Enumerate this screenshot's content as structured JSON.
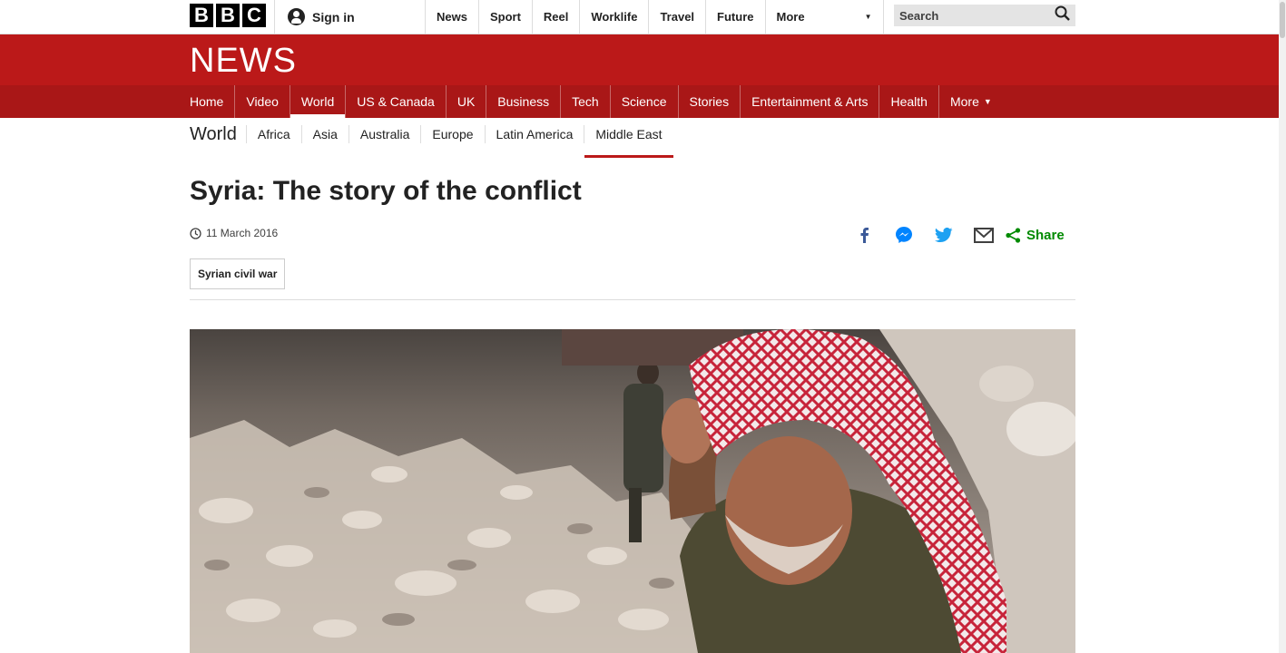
{
  "global_bar": {
    "logo_letters": [
      "B",
      "B",
      "C"
    ],
    "sign_in": "Sign in",
    "nav": [
      "News",
      "Sport",
      "Reel",
      "Worklife",
      "Travel",
      "Future"
    ],
    "more": "More",
    "search_placeholder": "Search"
  },
  "news_header": {
    "wordmark": "NEWS",
    "nav": [
      {
        "label": "Home",
        "active": false
      },
      {
        "label": "Video",
        "active": false
      },
      {
        "label": "World",
        "active": true
      },
      {
        "label": "US & Canada",
        "active": false
      },
      {
        "label": "UK",
        "active": false
      },
      {
        "label": "Business",
        "active": false
      },
      {
        "label": "Tech",
        "active": false
      },
      {
        "label": "Science",
        "active": false
      },
      {
        "label": "Stories",
        "active": false
      },
      {
        "label": "Entertainment & Arts",
        "active": false
      },
      {
        "label": "Health",
        "active": false
      },
      {
        "label": "More",
        "active": false
      }
    ]
  },
  "section_nav": {
    "title": "World",
    "items": [
      {
        "label": "Africa",
        "active": false
      },
      {
        "label": "Asia",
        "active": false
      },
      {
        "label": "Australia",
        "active": false
      },
      {
        "label": "Europe",
        "active": false
      },
      {
        "label": "Latin America",
        "active": false
      },
      {
        "label": "Middle East",
        "active": true
      }
    ]
  },
  "article": {
    "headline": "Syria: The story of the conflict",
    "date": "11 March 2016",
    "tag": "Syrian civil war",
    "share_label": "Share",
    "share_icons": [
      "facebook-icon",
      "messenger-icon",
      "twitter-icon",
      "email-icon"
    ]
  },
  "colors": {
    "brand_red": "#bb1919",
    "nav_red": "#a91717",
    "share_green": "#008a00",
    "facebook_blue": "#3b5998",
    "twitter_blue": "#1da1f2",
    "messenger_blue": "#0084ff"
  }
}
